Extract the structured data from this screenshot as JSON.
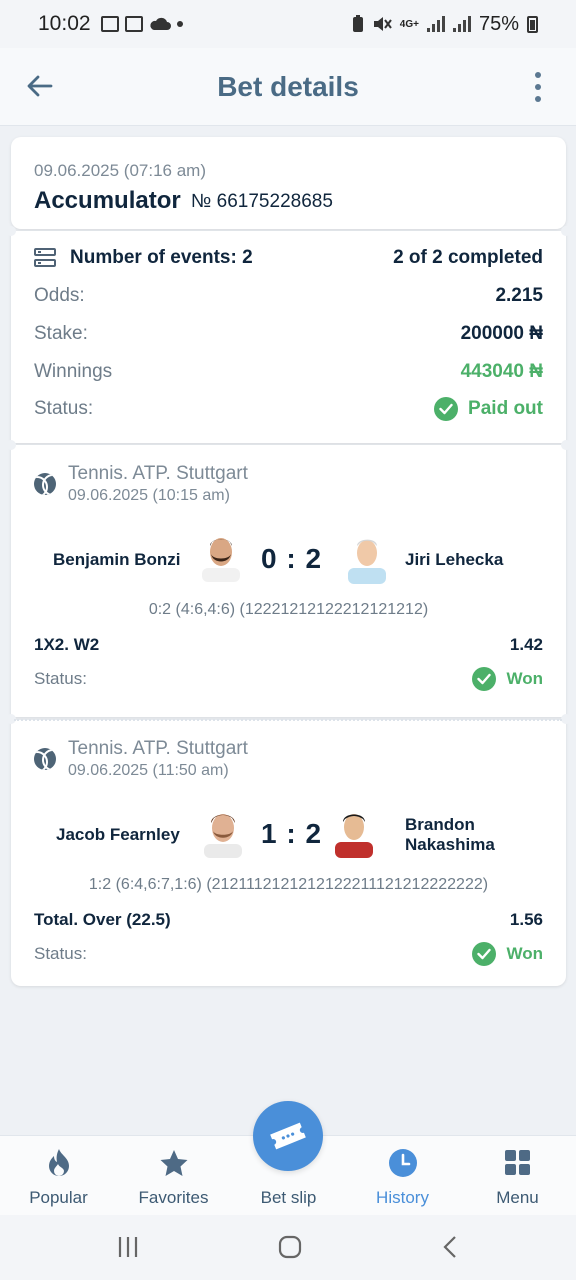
{
  "status_bar": {
    "time": "10:02",
    "battery": "75%",
    "network": "4G+"
  },
  "app_bar": {
    "title": "Bet details"
  },
  "bet": {
    "date": "09.06.2025 (07:16 am)",
    "type": "Accumulator",
    "number": "№ 66175228685",
    "events_label": "Number of events: 2",
    "completed": "2 of 2 completed",
    "odds_label": "Odds:",
    "odds": "2.215",
    "stake_label": "Stake:",
    "stake": "200000 ₦",
    "winnings_label": "Winnings",
    "winnings": "443040 ₦",
    "status_label": "Status:",
    "status": "Paid out"
  },
  "events": [
    {
      "league": "Tennis. ATP. Stuttgart",
      "date": "09.06.2025 (10:15 am)",
      "home": "Benjamin Bonzi",
      "away": "Jiri Lehecka",
      "score": "0 : 2",
      "detail": "0:2 (4:6,4:6) (12221212122212121212)",
      "market": "1X2. W2",
      "odds": "1.42",
      "status_label": "Status:",
      "status": "Won"
    },
    {
      "league": "Tennis. ATP. Stuttgart",
      "date": "09.06.2025 (11:50 am)",
      "home": "Jacob Fearnley",
      "away_line1": "Brandon",
      "away_line2": "Nakashima",
      "score": "1 : 2",
      "detail": "1:2 (6:4,6:7,1:6) (2121112121212122211121212222222)",
      "market": "Total. Over (22.5)",
      "odds": "1.56",
      "status_label": "Status:",
      "status": "Won"
    }
  ],
  "tabs": [
    {
      "label": "Popular",
      "icon": "fire-icon"
    },
    {
      "label": "Favorites",
      "icon": "star-icon"
    },
    {
      "label": "Bet slip",
      "icon": "ticket-icon"
    },
    {
      "label": "History",
      "icon": "clock-icon",
      "active": true
    },
    {
      "label": "Menu",
      "icon": "grid-icon"
    }
  ],
  "colors": {
    "accent": "#4a8fd9",
    "success": "#4cb069",
    "title": "#4a6b85",
    "text": "#10263d"
  }
}
